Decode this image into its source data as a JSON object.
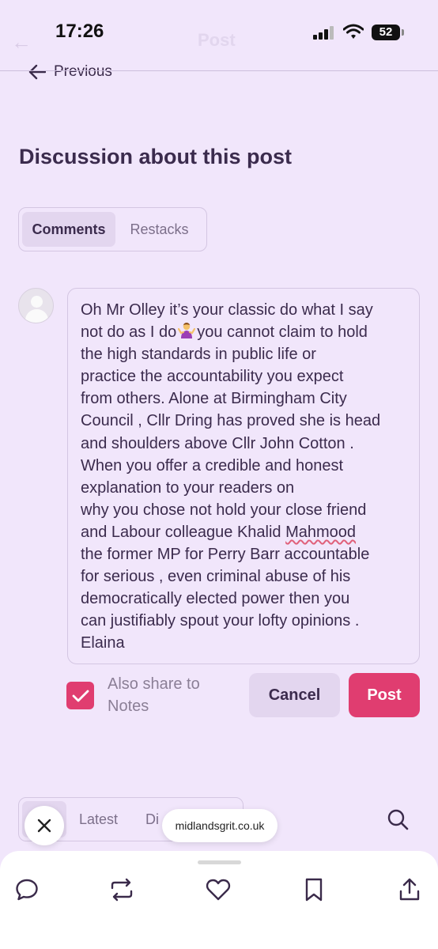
{
  "status_bar": {
    "time": "17:26",
    "battery": "52",
    "ghost_back": "←",
    "ghost_title": "Post"
  },
  "nav": {
    "previous_label": "Previous"
  },
  "discussion": {
    "title": "Discussion about this post",
    "tabs": [
      {
        "label": "Comments",
        "active": true
      },
      {
        "label": "Restacks",
        "active": false
      }
    ]
  },
  "comment": {
    "lines": [
      "Oh Mr Olley it’s your classic do what I say",
      "you cannot claim  to hold",
      "the high standards in public life or",
      "practice the accountability you expect",
      "from others. Alone at Birmingham City",
      "Council , Cllr Dring has proved she is head",
      "and shoulders above Cllr John Cotton .",
      "When you offer a credible and honest",
      "explanation  to your readers on",
      "why you chose not hold your close friend",
      "and Labour colleague  Khalid ",
      "Mahmood",
      "the former MP for Perry Barr  accountable",
      "for serious  , even criminal abuse of his",
      "democratically elected power then you",
      "can justifiably spout your lofty opinions .",
      "Elaina"
    ],
    "line2_prefix": "not do as I do",
    "emoji": "shrugging-woman-emoji"
  },
  "composer": {
    "share_label": "Also share to Notes",
    "share_checked": true,
    "cancel_label": "Cancel",
    "post_label": "Post"
  },
  "sort": {
    "latest_label": "Latest",
    "discussions_partial": "Di"
  },
  "browser": {
    "url": "midlandsgrit.co.uk"
  },
  "bottom_actions": [
    {
      "icon": "comment-icon"
    },
    {
      "icon": "restack-icon"
    },
    {
      "icon": "heart-icon"
    },
    {
      "icon": "bookmark-icon"
    },
    {
      "icon": "share-icon"
    }
  ],
  "colors": {
    "background": "#f1e6fb",
    "accent": "#e03d70",
    "tab_active": "#e3d6ef"
  }
}
